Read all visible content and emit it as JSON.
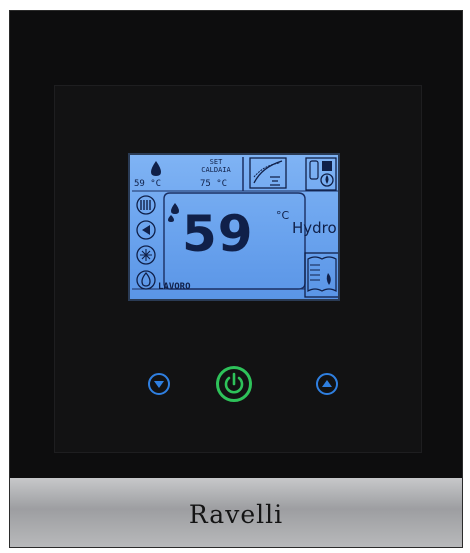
{
  "lcd": {
    "water_temp": "59 °C",
    "set_label_line1": "SET",
    "set_label_line2": "CALDAIA",
    "set_temp": "75 °C",
    "main_temp": "59",
    "main_unit": "°C",
    "mode_text": "Hydro",
    "status_text": "LAVORO"
  },
  "buttons": {
    "down": "down-arrow",
    "power": "power",
    "up": "up-arrow"
  },
  "brand": "Ravelli",
  "colors": {
    "lcd_background": "#6aa3ee",
    "lcd_text": "#102049",
    "power_button": "#2ec25a",
    "arrow_buttons": "#2f7fe0",
    "device_body": "#0d0d0e",
    "brand_strip": "#b0b1b3"
  }
}
